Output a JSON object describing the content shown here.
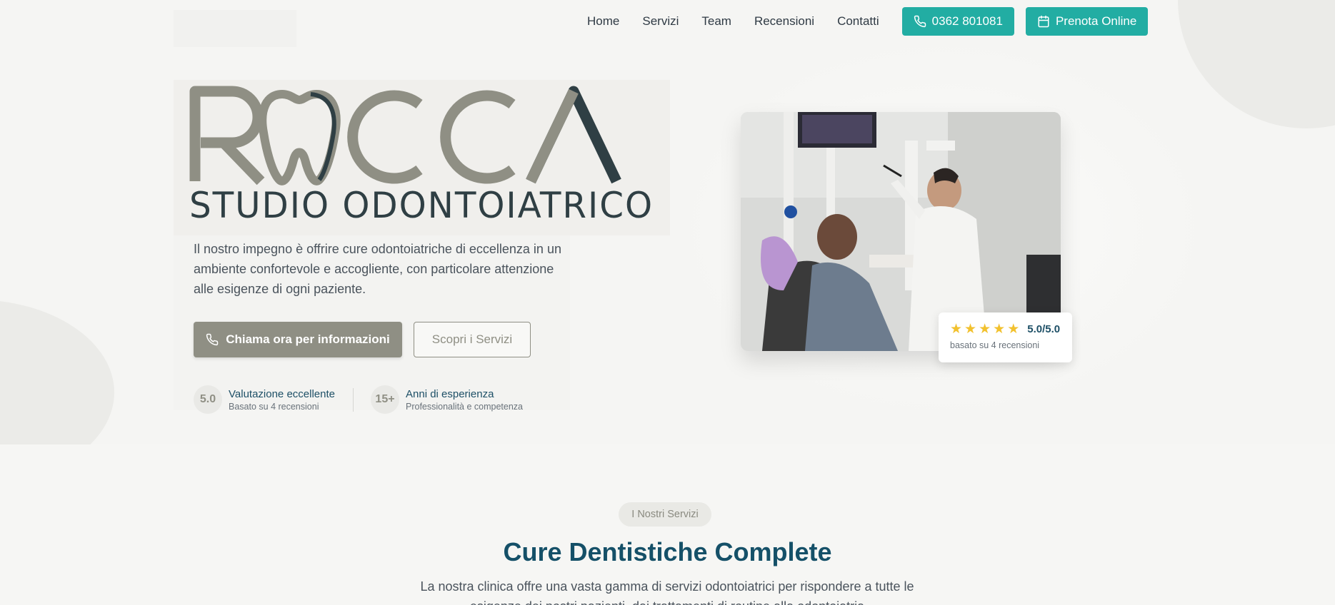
{
  "nav": {
    "links": [
      "Home",
      "Servizi",
      "Team",
      "Recensioni",
      "Contatti"
    ],
    "phone": "0362 801081",
    "book": "Prenota Online"
  },
  "logo": {
    "name": "ROCCA",
    "subtitle": "STUDIO ODONTOIATRICO"
  },
  "hero": {
    "intro": "Il nostro impegno è offrire cure odontoiatriche di eccellenza in un ambiente confortevole e accogliente, con particolare attenzione alle esigenze di ogni paziente.",
    "cta_primary": "Chiama ora per informazioni",
    "cta_secondary": "Scopri i Servizi",
    "stats": [
      {
        "value": "5.0",
        "title": "Valutazione eccellente",
        "sub": "Basato su 4 recensioni"
      },
      {
        "value": "15+",
        "title": "Anni di esperienza",
        "sub": "Professionalità e competenza"
      }
    ]
  },
  "rating": {
    "stars": 5,
    "value": "5.0/5.0",
    "sub": "basato su 4 recensioni"
  },
  "services": {
    "badge": "I Nostri Servizi",
    "title": "Cure Dentistiche Complete",
    "description": "La nostra clinica offre una vasta gamma di servizi odontoiatrici per rispondere a tutte le esigenze dei nostri pazienti, dai trattamenti di routine alla odontoiatria"
  },
  "colors": {
    "teal": "#22ada3",
    "taupe": "#8f8f84",
    "navy": "#155068",
    "star": "#f2c12e"
  }
}
